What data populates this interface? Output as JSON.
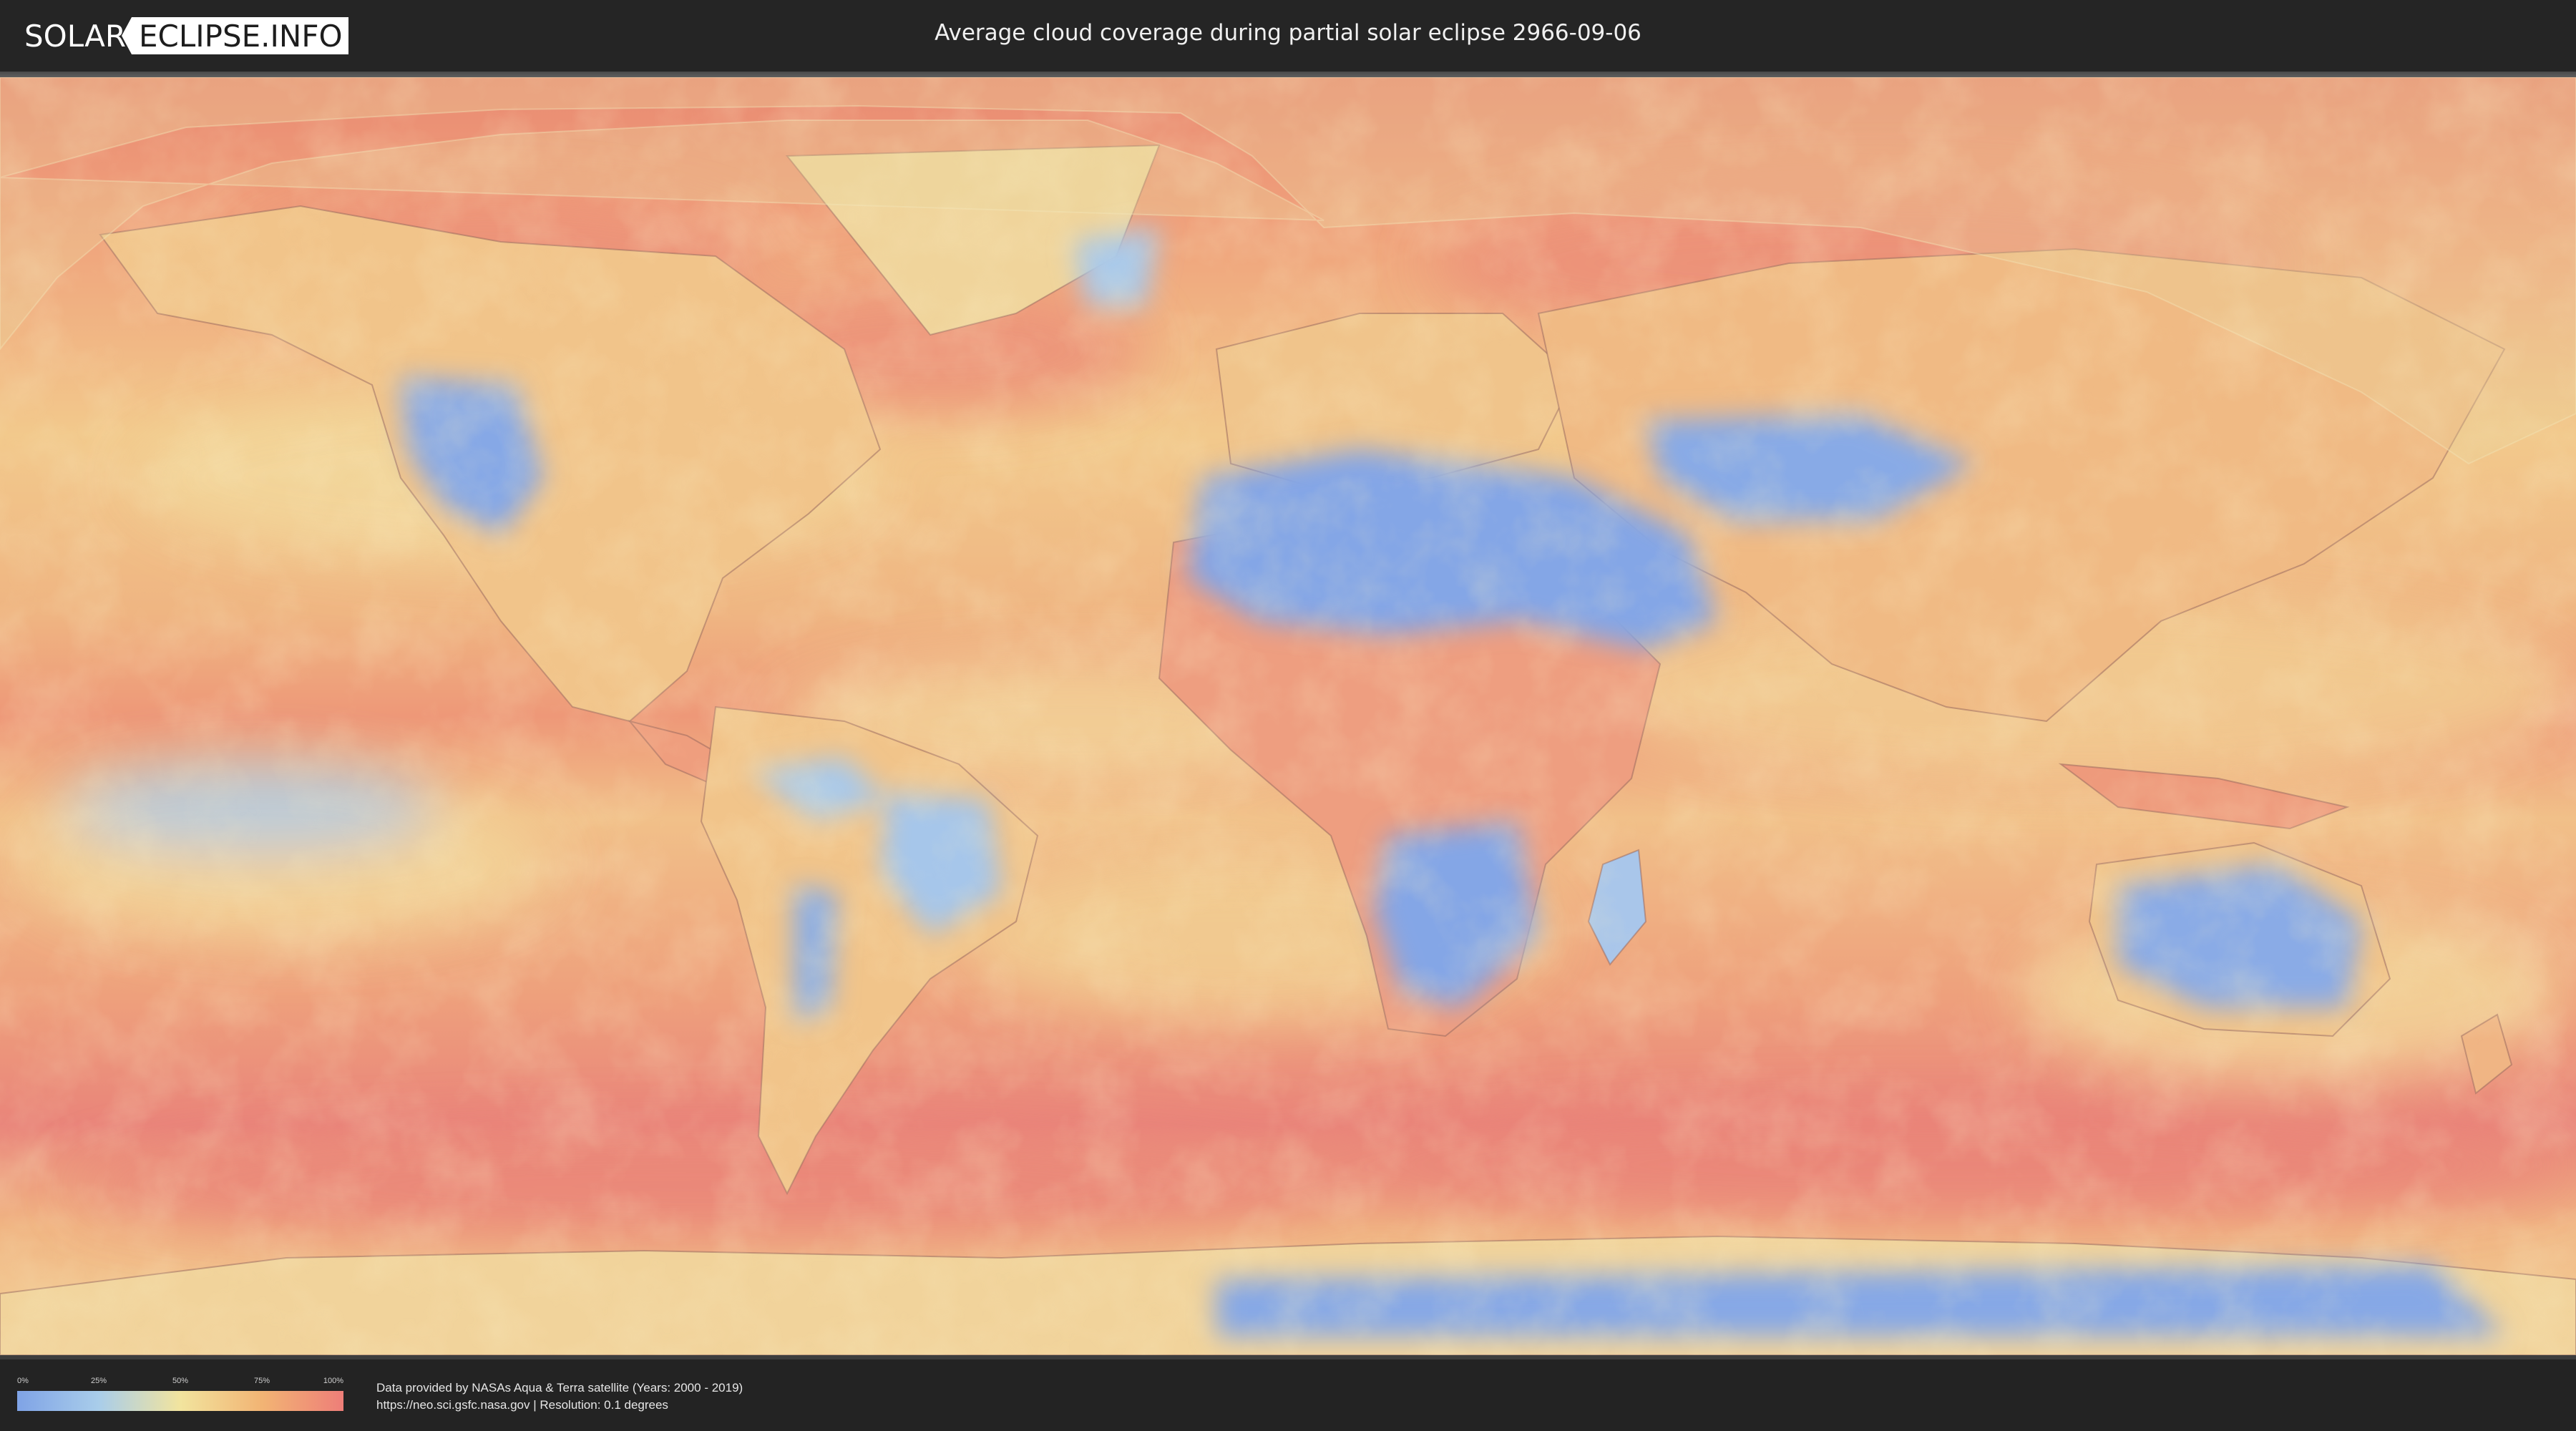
{
  "header": {
    "logo_left": "SOLAR",
    "logo_right": "ECLIPSE.INFO",
    "title": "Average cloud coverage during partial solar eclipse 2966-09-06"
  },
  "legend": {
    "ticks": [
      "0%",
      "25%",
      "50%",
      "75%",
      "100%"
    ],
    "colors": [
      "#7fa3e6",
      "#a9cdea",
      "#f2e49e",
      "#f2b474",
      "#ee7e78"
    ]
  },
  "credits": {
    "line1": "Data provided by NASAs Aqua & Terra satellite (Years: 2000 - 2019)",
    "line2": "https://neo.sci.gsfc.nasa.gov | Resolution: 0.1 degrees"
  },
  "map": {
    "ocean_color": "#ef9f7c",
    "land_clear_color": "#86a8e6",
    "eclipse_overlay_color": "#e9d8a0"
  }
}
